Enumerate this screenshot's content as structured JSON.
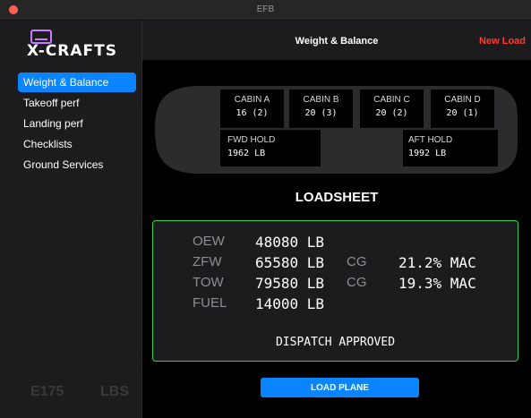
{
  "window": {
    "title": "EFB"
  },
  "sidebar": {
    "logo": "X-CRAFTS",
    "items": [
      {
        "label": "Weight & Balance",
        "active": true
      },
      {
        "label": "Takeoff perf"
      },
      {
        "label": "Landing perf"
      },
      {
        "label": "Checklists"
      },
      {
        "label": "Ground Services"
      }
    ],
    "footer": {
      "aircraft": "E175",
      "unit": "LBS"
    }
  },
  "header": {
    "title": "Weight & Balance",
    "action": "New Load"
  },
  "plane": {
    "cabins": [
      {
        "label": "CABIN A",
        "value": "16 (2)"
      },
      {
        "label": "CABIN B",
        "value": "20 (3)"
      },
      {
        "label": "CABIN C",
        "value": "20 (2)"
      },
      {
        "label": "CABIN D",
        "value": "20 (1)"
      }
    ],
    "fwd_hold": {
      "label": "FWD HOLD",
      "value": "1962 LB"
    },
    "aft_hold": {
      "label": "AFT HOLD",
      "value": "1992 LB"
    }
  },
  "loadsheet": {
    "title": "LOADSHEET",
    "rows": [
      {
        "key": "OEW",
        "value": "48080 LB"
      },
      {
        "key": "ZFW",
        "value": "65580 LB",
        "cg_label": "CG",
        "cg_value": "21.2% MAC"
      },
      {
        "key": "TOW",
        "value": "79580 LB",
        "cg_label": "CG",
        "cg_value": "19.3% MAC"
      },
      {
        "key": "FUEL",
        "value": "14000 LB"
      }
    ],
    "status": "DISPATCH APPROVED"
  },
  "actions": {
    "load_plane": "LOAD PLANE"
  },
  "colors": {
    "accent": "#0a84ff",
    "danger": "#ff3b30",
    "approved": "#30d158",
    "logo": "#c77dff"
  }
}
